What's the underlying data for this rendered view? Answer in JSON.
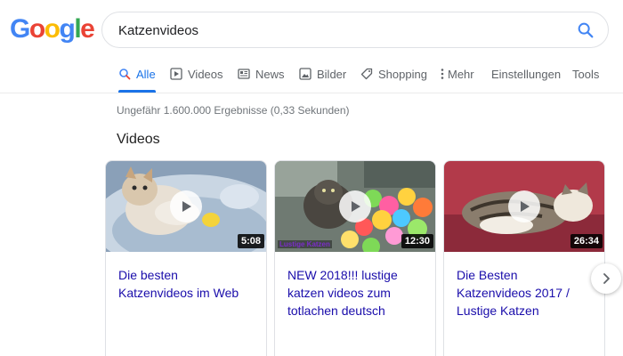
{
  "logo": {
    "letters": [
      "G",
      "o",
      "o",
      "g",
      "l",
      "e"
    ],
    "colors": [
      "#4285F4",
      "#EA4335",
      "#FBBC05",
      "#4285F4",
      "#34A853",
      "#EA4335"
    ]
  },
  "search": {
    "value": "Katzenvideos",
    "icon": "search-icon"
  },
  "tabs": [
    {
      "label": "Alle",
      "icon": "search-icon",
      "active": true
    },
    {
      "label": "Videos",
      "icon": "video-icon",
      "active": false
    },
    {
      "label": "News",
      "icon": "newspaper-icon",
      "active": false
    },
    {
      "label": "Bilder",
      "icon": "image-icon",
      "active": false
    },
    {
      "label": "Shopping",
      "icon": "tag-icon",
      "active": false
    },
    {
      "label": "Mehr",
      "icon": "more-vert-icon",
      "active": false
    },
    {
      "label": "Einstellungen",
      "active": false
    },
    {
      "label": "Tools",
      "active": false
    }
  ],
  "results": {
    "stats": "Ungefähr 1.600.000 Ergebnisse (0,33 Sekunden)",
    "section_title": "Videos"
  },
  "videos": [
    {
      "title": "Die besten Katzenvideos im Web",
      "duration": "5:08"
    },
    {
      "title": "NEW 2018!!! lustige katzen videos zum totlachen deutsch",
      "duration": "12:30",
      "overlay": "Lustige Katzen"
    },
    {
      "title": "Die Besten Katzenvideos 2017 / Lustige Katzen",
      "duration": "26:34"
    }
  ],
  "colors": {
    "accent": "#1a73e8",
    "link": "#1a0dab",
    "muted": "#70757a"
  }
}
